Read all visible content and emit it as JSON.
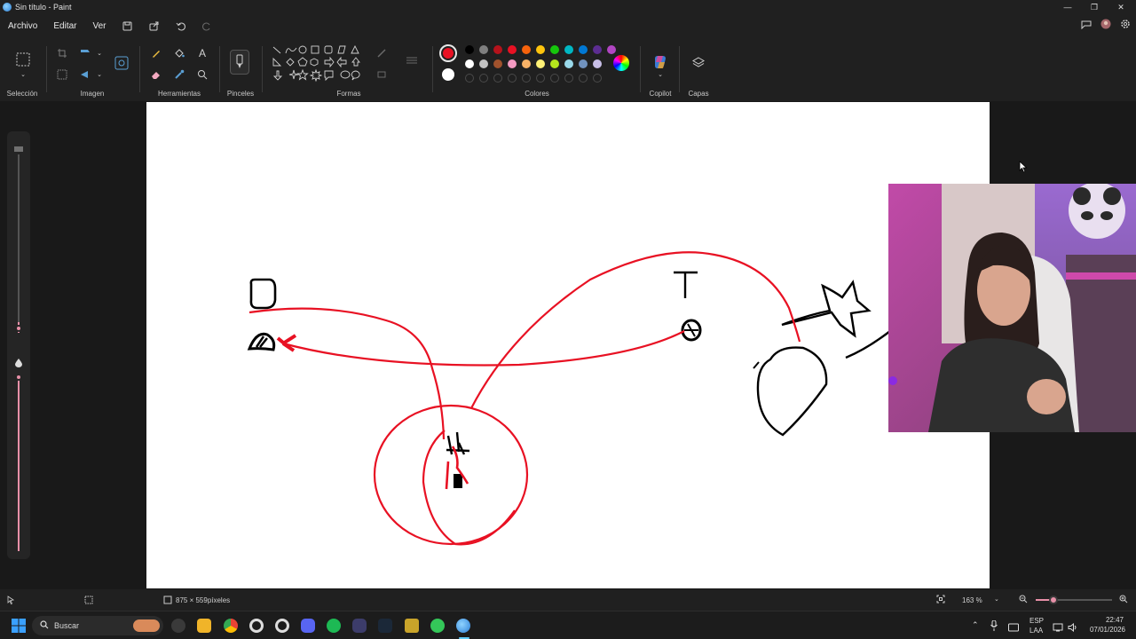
{
  "window": {
    "title": "Sin título - Paint"
  },
  "menu": {
    "archivo": "Archivo",
    "editar": "Editar",
    "ver": "Ver"
  },
  "ribbon": {
    "seleccion": "Selección",
    "imagen": "Imagen",
    "herramientas": "Herramientas",
    "pinceles": "Pinceles",
    "formas": "Formas",
    "colores": "Colores",
    "copilot": "Copilot",
    "capas": "Capas"
  },
  "colors": {
    "primary": "#e81123",
    "secondary": "#ffffff",
    "palette_row1": [
      "#000000",
      "#7f7f7f",
      "#b5121b",
      "#e81123",
      "#f7630c",
      "#ffc40d",
      "#16c60c",
      "#00b7c3",
      "#0078d4",
      "#5c2d91",
      "#b146c2"
    ],
    "palette_row2": [
      "#ffffff",
      "#c3c3c3",
      "#a0522d",
      "#f49ac2",
      "#f7b267",
      "#fff176",
      "#b5e61d",
      "#99d9ea",
      "#7092be",
      "#c8bfe7"
    ]
  },
  "status": {
    "canvas_size": "875 × 559píxeles",
    "zoom": "163 %"
  },
  "taskbar": {
    "search_placeholder": "Buscar",
    "lang": "ESP",
    "lang_sub": "LAA",
    "time": "22:47",
    "date": "07/01/2026"
  },
  "drawing": {
    "text_o": "O",
    "text_t": "T"
  }
}
